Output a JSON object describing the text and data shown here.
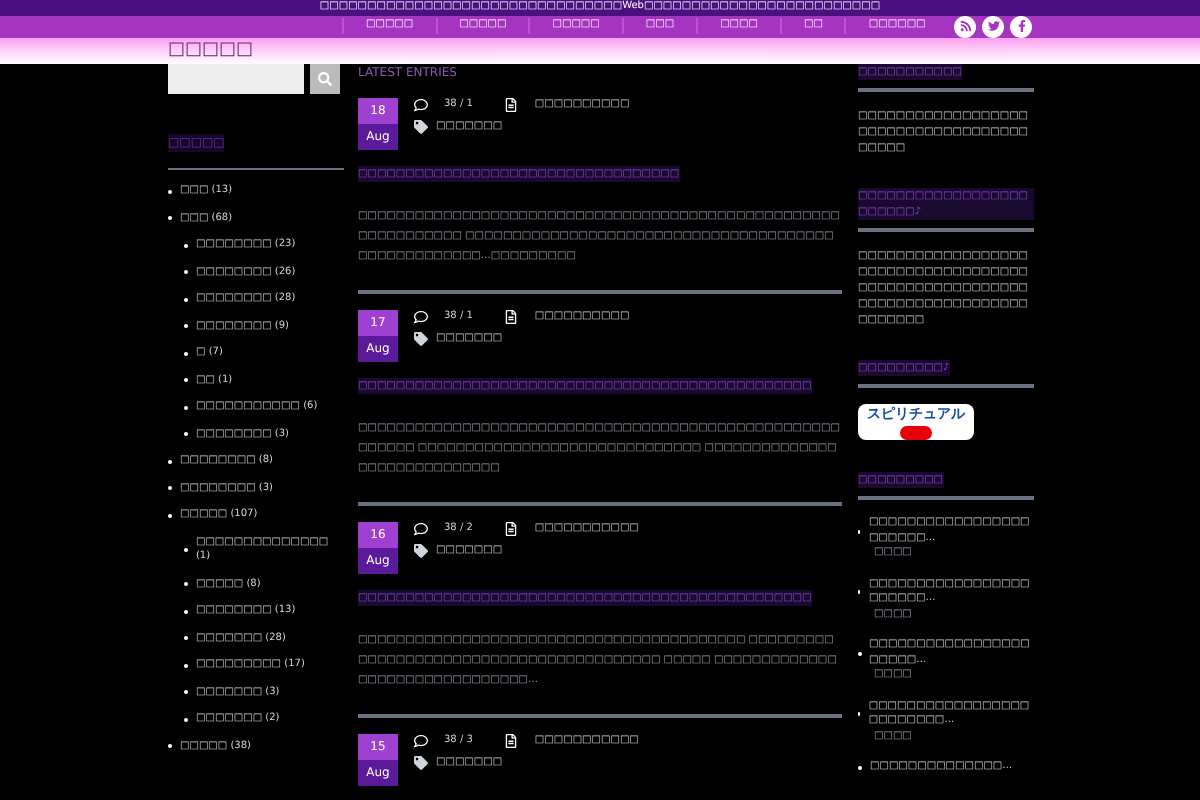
{
  "top_bar": {
    "text": "□□□□□□□□□□□□□□□□□□□□□□□□□□□□□□□□Web□□□□□□□□□□□□□□□□□□□□□□□□□"
  },
  "nav": {
    "items": [
      {
        "label": "□□□□□"
      },
      {
        "label": "□□□□□"
      },
      {
        "label": "□□□□□"
      },
      {
        "label": "□□□"
      },
      {
        "label": "□□□□"
      },
      {
        "label": "□□"
      },
      {
        "label": "□□□□□□"
      }
    ]
  },
  "header": {
    "site_title": "□□□□□"
  },
  "categories": {
    "title": "□□□□□",
    "items": [
      {
        "label": "□□□",
        "count": "(13)"
      },
      {
        "label": "□□□",
        "count": "(68)",
        "children": [
          {
            "label": "□□□□□□□□",
            "count": "(23)"
          },
          {
            "label": "□□□□□□□□",
            "count": "(26)"
          },
          {
            "label": "□□□□□□□□",
            "count": "(28)"
          },
          {
            "label": "□□□□□□□□",
            "count": "(9)"
          },
          {
            "label": "□",
            "count": "(7)"
          },
          {
            "label": "□□",
            "count": "(1)"
          },
          {
            "label": "□□□□□□□□□□□",
            "count": "(6)"
          },
          {
            "label": "□□□□□□□□",
            "count": "(3)"
          }
        ]
      },
      {
        "label": "□□□□□□□□",
        "count": "(8)"
      },
      {
        "label": "□□□□□□□□",
        "count": "(3)"
      },
      {
        "label": "□□□□□",
        "count": "(107)",
        "children": [
          {
            "label": "□□□□□□□□□□□□□□",
            "count": "(1)"
          },
          {
            "label": "□□□□□",
            "count": "(8)"
          },
          {
            "label": "□□□□□□□□",
            "count": "(13)"
          },
          {
            "label": "□□□□□□□",
            "count": "(28)"
          },
          {
            "label": "□□□□□□□□□",
            "count": "(17)"
          },
          {
            "label": "□□□□□□□",
            "count": "(3)"
          },
          {
            "label": "□□□□□□□",
            "count": "(2)"
          }
        ]
      },
      {
        "label": "□□□□□",
        "count": "(38)"
      }
    ]
  },
  "latest": {
    "title": "LATEST ENTRIES",
    "posts": [
      {
        "day": "18",
        "month": "Aug",
        "comments": "38 / 1",
        "category": "□□□□□□□□□□",
        "tag": "□□□□□□□",
        "title": "□□□□□□□□□□□□□□□□□□□□□□□□□□□□□□□□□□",
        "excerpt": "□□□□□□□□□□□□□□□□□□□□□□□□□□□□□□□□□□□□□□□□□□□□□□□□□□□□□□□□□□□□□□ □□□□□□□□□□□□□□□□□□□□□□□□□□□□□□□□□□□□□□□□□□□□□□□□□□□□…□□□□□□□□□"
      },
      {
        "day": "17",
        "month": "Aug",
        "comments": "38 / 1",
        "category": "□□□□□□□□□□",
        "tag": "□□□□□□□",
        "title": "□□□□□□□□□□□□□□□□□□□□□□□□□□□□□□□□□□□□□□□□□□□□□□□□",
        "excerpt": "□□□□□□□□□□□□□□□□□□□□□□□□□□□□□□□□□□□□□□□□□□□□□□□□□□□□□□□□□ □□□□□□□□□□□□□□□□□□□□□□□□□□□□□□ □□□□□□□□□□□□□□□□□□□□□□□□□□□□□"
      },
      {
        "day": "16",
        "month": "Aug",
        "comments": "38 / 2",
        "category": "□□□□□□□□□□□",
        "tag": "□□□□□□□",
        "title": "□□□□□□□□□□□□□□□□□□□□□□□□□□□□□□□□□□□□□□□□□□□□□□□□",
        "excerpt": "□□□□□□□□□□□□□□□□□□□□□□□□□□□□□□□□□□□□□□□□□ □□□□□□□□□□□□□□□□□□□□□□□□□□□□□□□□□□□□□□□□□ □□□□□ □□□□□□□□□□□□□□□□□□□□□□□□□□□□□□□…"
      },
      {
        "day": "15",
        "month": "Aug",
        "comments": "38 / 3",
        "category": "□□□□□□□□□□□",
        "tag": "□□□□□□□"
      }
    ]
  },
  "sidebar": {
    "widgets": [
      {
        "kind": "text",
        "title": "□□□□□□□□□□□",
        "text": "□□□□□□□□□□□□□□□□□□□□□□□□□□□□□□□□□□□□□□□□□"
      },
      {
        "kind": "text",
        "title": "□□□□□□□□□□□□□□□□□□□□□□□□♪",
        "text": "□□□□□□□□□□□□□□□□□□□□□□□□□□□□□□□□□□□□□□□□□□□□□□□□□□□□□□□□□□□□□□□□□□□□□□□□□□□□□□□"
      },
      {
        "kind": "banner",
        "title": "□□□□□□□□□♪",
        "text": "スピリチュアル"
      },
      {
        "kind": "list",
        "title": "□□□□□□□□□",
        "items": [
          {
            "title": "□□□□□□□□□□□□□□□□□□□□□□□…",
            "meta": "□□□□"
          },
          {
            "title": "□□□□□□□□□□□□□□□□□□□□□□□…",
            "meta": "□□□□"
          },
          {
            "title": "□□□□□□□□□□□□□□□□□□□□□□…",
            "meta": "□□□□"
          },
          {
            "title": "□□□□□□□□□□□□□□□□□□□□□□□□□…",
            "meta": "□□□□"
          },
          {
            "title": "□□□□□□□□□□□□□□…"
          }
        ]
      }
    ]
  }
}
